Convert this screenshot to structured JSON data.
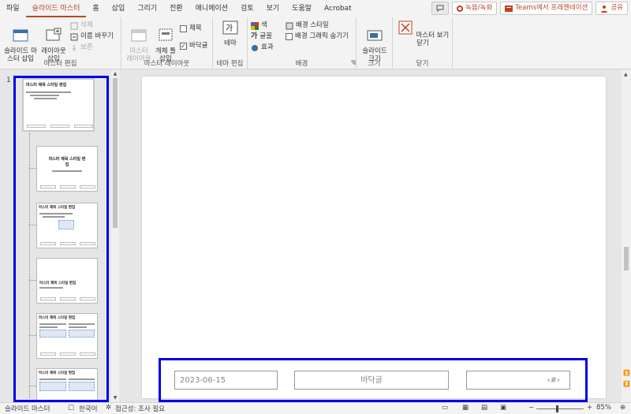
{
  "tabs": [
    {
      "label": "파일",
      "active": false
    },
    {
      "label": "슬라이드 마스터",
      "active": true
    },
    {
      "label": "홈",
      "active": false
    },
    {
      "label": "삽입",
      "active": false
    },
    {
      "label": "그리기",
      "active": false
    },
    {
      "label": "전환",
      "active": false
    },
    {
      "label": "애니메이션",
      "active": false
    },
    {
      "label": "검토",
      "active": false
    },
    {
      "label": "보기",
      "active": false
    },
    {
      "label": "도움말",
      "active": false
    },
    {
      "label": "Acrobat",
      "active": false
    }
  ],
  "top_right": {
    "record_label": "녹음/녹화",
    "teams_label": "Teams에서 프레젠테이션",
    "share_label": "공유"
  },
  "ribbon": {
    "master_edit": {
      "label": "마스터 편집",
      "insert_master": "슬라이드 마\n스터 삽입",
      "insert_layout": "레이아웃\n삽입",
      "delete": "삭제",
      "rename": "이름 바꾸기",
      "preserve": "보존"
    },
    "master_layout": {
      "label": "마스터 레이아웃",
      "master_btn": "마스터\n레이아웃",
      "insert_placeholder": "개체 틀\n삽입",
      "title_chk": "제목",
      "footer_chk": "바닥글"
    },
    "theme_edit": {
      "label": "테마 편집",
      "theme_btn": "테마"
    },
    "background": {
      "label": "배경",
      "colors": "색",
      "fonts": "글꼴",
      "effects": "효과",
      "bg_styles": "배경 스타일",
      "hide_bg": "배경 그래픽 숨기기"
    },
    "size": {
      "label": "크기",
      "slide_size": "슬라이드\n크기"
    },
    "close": {
      "label": "닫기",
      "close_master": "마스터 보기 닫기"
    }
  },
  "thumbs": {
    "slide_number": "1",
    "master_title": "마스터 제목 스타일 편집",
    "layout_title_center": "마스터 제목 스타일 편\n집",
    "layout_title": "마스터 제목 스타일 편집"
  },
  "slide": {
    "date": "2023-06-15",
    "footer": "바닥글",
    "number": "‹#›"
  },
  "status": {
    "view": "슬라이드 마스터",
    "language": "한국어",
    "accessibility": "접근성: 조사 필요",
    "zoom": "85%"
  }
}
